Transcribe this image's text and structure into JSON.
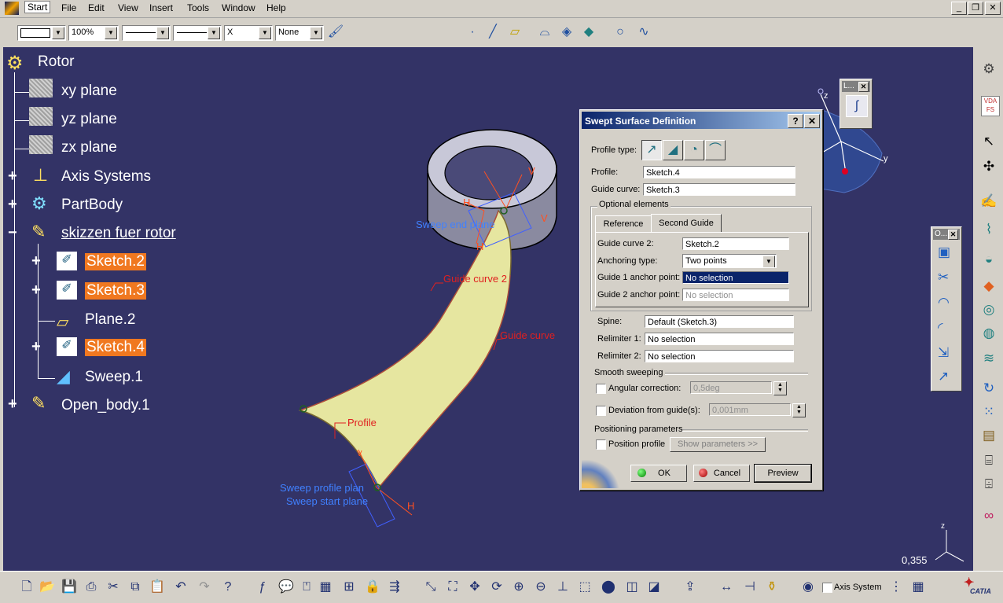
{
  "menubar": {
    "items": [
      "Start",
      "File",
      "Edit",
      "View",
      "Insert",
      "Tools",
      "Window",
      "Help"
    ]
  },
  "toolbar_top": {
    "zoom_value": "100%",
    "point_style": "X",
    "layer_value": "None"
  },
  "tree": {
    "root": "Rotor",
    "items": [
      "xy plane",
      "yz plane",
      "zx plane",
      "Axis Systems",
      "PartBody",
      "skizzen fuer rotor",
      "Sketch.2",
      "Sketch.3",
      "Plane.2",
      "Sketch.4",
      "Sweep.1",
      "Open_body.1"
    ]
  },
  "viewport": {
    "annotations": {
      "sweep_end_plane": "Sweep end plane",
      "guide_curve_2": "Guide curve 2",
      "guide_curve": "Guide curve",
      "profile": "Profile",
      "sweep_profile_plane": "Sweep profile plan",
      "sweep_start_plane": "Sweep start plane"
    },
    "axis_v": "V",
    "axis_h": "H",
    "axis_z": "z",
    "axis_y": "y",
    "scale_value": "0,355",
    "compass_labels": [
      "z",
      "y"
    ]
  },
  "dialog": {
    "title": "Swept Surface Definition",
    "help_btn": "?",
    "close_btn": "✕",
    "profile_type_label": "Profile type:",
    "profile_label": "Profile:",
    "profile_value": "Sketch.4",
    "guide_curve_label": "Guide curve:",
    "guide_curve_value": "Sketch.3",
    "optional_elements": "Optional elements",
    "tabs": [
      "Reference",
      "Second Guide"
    ],
    "guide_curve_2_label": "Guide curve 2:",
    "guide_curve_2_value": "Sketch.2",
    "anchoring_type_label": "Anchoring type:",
    "anchoring_type_value": "Two points",
    "guide1_anchor_label": "Guide 1 anchor point:",
    "guide1_anchor_value": "No selection",
    "guide2_anchor_label": "Guide 2 anchor point:",
    "guide2_anchor_value": "No selection",
    "spine_label": "Spine:",
    "spine_value": "Default (Sketch.3)",
    "relimiter1_label": "Relimiter 1:",
    "relimiter1_value": "No selection",
    "relimiter2_label": "Relimiter 2:",
    "relimiter2_value": "No selection",
    "smooth_sweeping": "Smooth sweeping",
    "angular_correction_label": "Angular correction:",
    "angular_correction_value": "0,5deg",
    "deviation_label": "Deviation from guide(s):",
    "deviation_value": "0,001mm",
    "positioning_parameters": "Positioning parameters",
    "position_profile_label": "Position profile",
    "show_parameters_btn": "Show parameters >>",
    "ok_btn": "OK",
    "cancel_btn": "Cancel",
    "preview_btn": "Preview"
  },
  "mini_panels": {
    "law_title": "L...",
    "ops_title": "O..."
  },
  "bottombar": {
    "axis_system_label": "Axis System"
  },
  "brand": {
    "vda_label": "VDA FS",
    "catia_label": "CATIA"
  },
  "colors": {
    "viewport_bg": "#333366",
    "selected_highlight": "#f07820",
    "surface": "#e6e6a0",
    "dialog_title_start": "#0a246a"
  }
}
